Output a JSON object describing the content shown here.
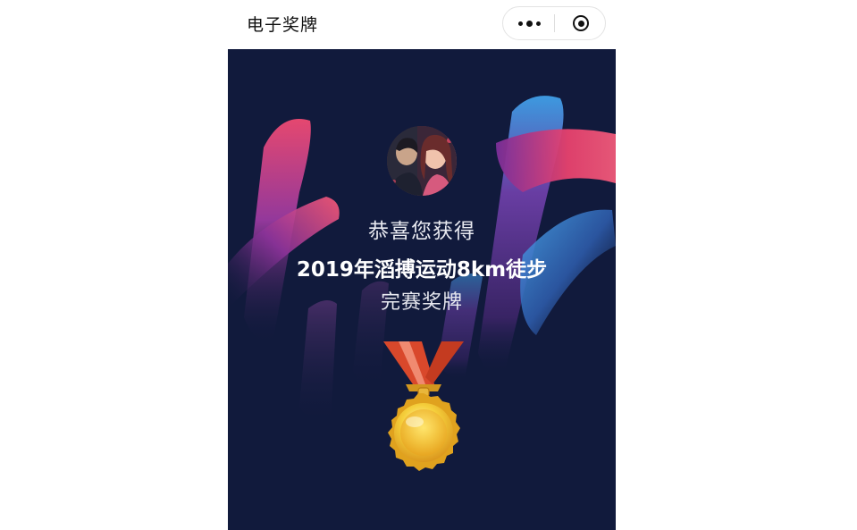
{
  "navbar": {
    "title": "电子奖牌",
    "more_icon": "more-dots-icon",
    "close_icon": "target-close-icon"
  },
  "certificate": {
    "congrats_text": "恭喜您获得",
    "event_name": "2019年滔搏运动8km徒步",
    "award_text": "完赛奖牌",
    "avatar": "user-avatar-photo",
    "medal": "gold-medal-icon"
  },
  "colors": {
    "background": "#111a3c",
    "stroke_pink": "#e8426e",
    "stroke_purple": "#7b3fa0",
    "stroke_blue": "#3a8fd6",
    "medal_gold": "#f2c233",
    "ribbon_red": "#d9482b"
  }
}
